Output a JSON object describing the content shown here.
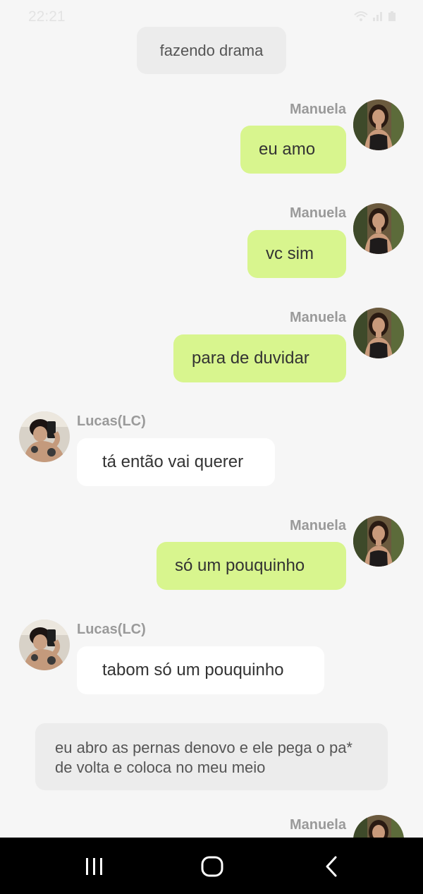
{
  "status_bar": {
    "time": "22:21"
  },
  "chat": {
    "narration_top": "fazendo drama",
    "messages": [
      {
        "sender": "Manuela",
        "text": "eu amo"
      },
      {
        "sender": "Manuela",
        "text": "vc sim"
      },
      {
        "sender": "Manuela",
        "text": "para de duvidar"
      },
      {
        "sender": "Lucas(LC)",
        "text": "tá então vai querer"
      },
      {
        "sender": "Manuela",
        "text": "só um pouquinho"
      },
      {
        "sender": "Lucas(LC)",
        "text": "tabom só um pouquinho"
      }
    ],
    "narration_bottom": "eu abro as pernas denovo e ele pega o pa* de volta e coloca no meu meio",
    "partial_sender": "Manuela"
  },
  "nav_bar": {
    "recent_icon": "recent-apps-icon",
    "home_icon": "home-icon",
    "back_icon": "back-icon"
  },
  "colors": {
    "background": "#f6f6f6",
    "outgoing_bubble": "#d8f58e",
    "incoming_bubble": "#ffffff",
    "narration_bubble": "#ececec",
    "sender_name": "#9a9a9a",
    "nav_bar": "#000000"
  }
}
